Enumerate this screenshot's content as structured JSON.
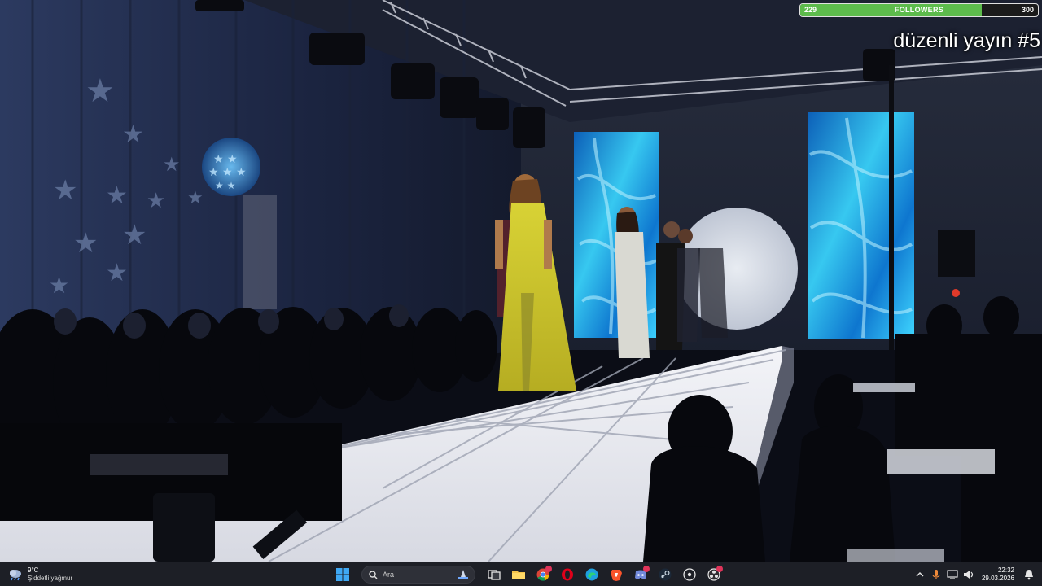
{
  "overlay": {
    "followers": {
      "current": "229",
      "label": "FOLLOWERS",
      "goal": "300",
      "progress": 0.763
    },
    "stream_title": "düzenli yayın #5"
  },
  "taskbar": {
    "weather": {
      "temperature": "9°C",
      "condition": "Şiddetli yağmur"
    },
    "search_placeholder": "Ara",
    "pinned_apps": [
      "windows-start",
      "search",
      "task-view",
      "file-explorer",
      "chrome",
      "opera",
      "edge",
      "brave",
      "discord",
      "steam",
      "media-player",
      "obs"
    ],
    "clock": {
      "time": "22:32",
      "date": "29.03.2026"
    }
  },
  "colors": {
    "follower_fill": "#5dbb4c",
    "taskbar_bg": "#1d1f26",
    "runway_light": "#e8eaf0",
    "screen_cyan": "#37c8f0",
    "dress_yellow": "#c9c22c"
  }
}
